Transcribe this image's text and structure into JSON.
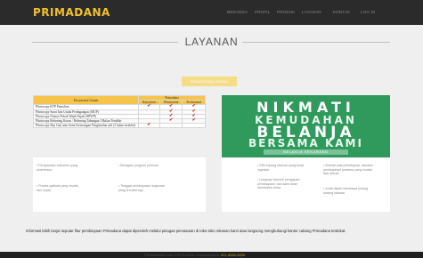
{
  "header": {
    "brand": "PRIMADANA",
    "nav": [
      "BERANDA",
      "PROFIL",
      "PRODUK",
      "LAYANAN",
      "KONTAK",
      "LOG IN"
    ]
  },
  "page": {
    "title": "LAYANAN",
    "cta_label": "PEMASARAN RESMI"
  },
  "services_table": {
    "header_left": "Persyaratan Umum",
    "header_group": "Primadana",
    "subheaders": [
      "Karyawan",
      "Wiraswasta",
      "Profesional"
    ],
    "rows": [
      {
        "label": "Photocopy KTP Pemohon",
        "checks": [
          "✔",
          "✔",
          "✔"
        ]
      },
      {
        "label": "Photocopy Surat Izin Usaha Perdagangan (SIUP)",
        "checks": [
          "",
          "✔",
          "✔"
        ]
      },
      {
        "label": "Photocopy Nomor Pokok Wajib Pajak (NPWP)",
        "checks": [
          "",
          "✔",
          "✔"
        ]
      },
      {
        "label": "Photocopy Rekening Koran / Rekening Tabungan 3 Bulan Terakhir",
        "checks": [
          "",
          "✔",
          "✔"
        ]
      },
      {
        "label": "Photocopy Slip Gaji atau Surat Keterangan Penghasilan asli (3 bulan terakhir)",
        "checks": [
          "✔",
          "",
          ""
        ]
      }
    ]
  },
  "promo": {
    "line1": "NIKMATI",
    "line2": "KEMUDAHAN",
    "line3": "BELANJA",
    "line4": "BERSAMA KAMI",
    "tagline": "BELANJA SEKARANG"
  },
  "left_card": {
    "col1": [
      "Persyaratan dokumen yang sederhana",
      "Proses aplikasi yang mudah dan cepat"
    ],
    "col2": [
      "Beragam program promosi",
      "Tenggat pembayaran angsuran yang tercatat rapi"
    ]
  },
  "right_card": {
    "col1": [
      "Pilih barang idaman yang Anda inginkan",
      "Lengkapi formulir pengajuan pembiayaan, dan kami akan membantu Anda"
    ],
    "col2": [
      "Setelah ada persetujuan, lakukan pembayaran pertama yang mudah dan sesuai",
      "Anda dapat membawa pulang barang idaman"
    ]
  },
  "info_text": "Informasi lebih lanjut seputar fitur pembiayaan Primadana dapat diperoleh melalui petugas pemasaran di toko-toko rekanan kami atau langsung menghubungi kantor cabang Primadana terdekat.",
  "footer": {
    "text": "PRIMADANA HAK CIPTA 2019 | Hubungi Kami:",
    "link": "021-5555-5555"
  },
  "colors": {
    "brand": "#f2c12e",
    "topbar": "#2b2b2b",
    "promo": "#2f9a5b",
    "table_header": "#f6c44a"
  }
}
